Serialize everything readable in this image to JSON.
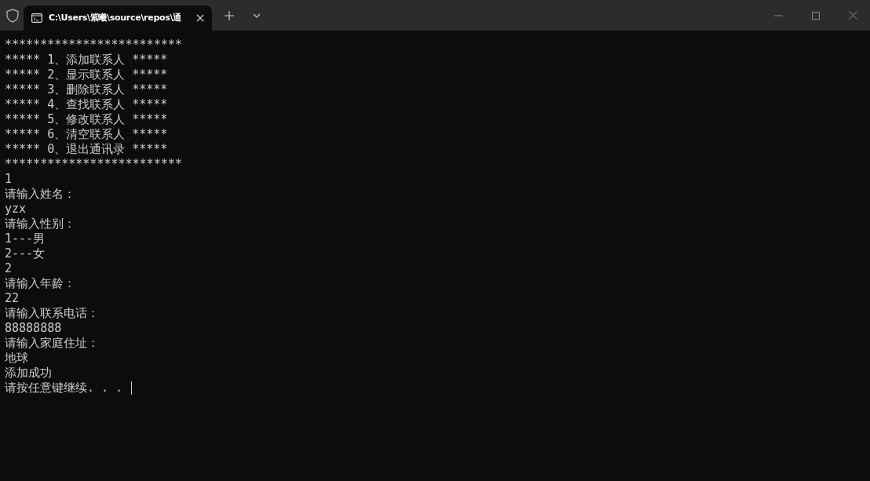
{
  "window": {
    "tab": {
      "title": "C:\\Users\\紫曦\\source\\repos\\通",
      "selected": true
    }
  },
  "console": {
    "lines": [
      "*************************",
      "***** 1、添加联系人 *****",
      "***** 2、显示联系人 *****",
      "***** 3、删除联系人 *****",
      "***** 4、查找联系人 *****",
      "***** 5、修改联系人 *****",
      "***** 6、清空联系人 *****",
      "***** 0、退出通讯录 *****",
      "*************************",
      "1",
      "请输入姓名：",
      "yzx",
      "请输入性别：",
      "1---男",
      "2---女",
      "2",
      "请输入年龄：",
      "22",
      "请输入联系电话：",
      "88888888",
      "请输入家庭住址：",
      "地球",
      "添加成功",
      "请按任意键继续. . . "
    ],
    "cursor": true
  }
}
